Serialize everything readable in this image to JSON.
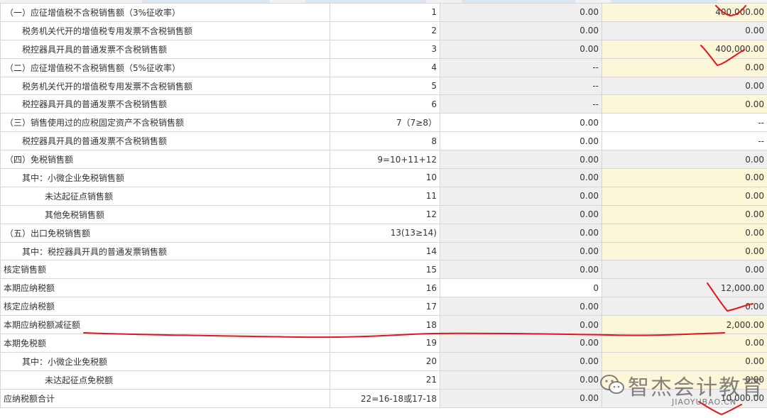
{
  "rows": [
    {
      "name": "（一）应征增值税不含税销售额（3%征收率）",
      "line": "1",
      "v1": "0.00",
      "v2": "400,000.00"
    },
    {
      "name": "税务机关代开的增值税专用发票不含税销售额",
      "line": "2",
      "v1": "0.00",
      "v2": "0.00"
    },
    {
      "name": "税控器具开具的普通发票不含税销售额",
      "line": "3",
      "v1": "0.00",
      "v2": "400,000.00"
    },
    {
      "name": "（二）应征增值税不含税销售额（5%征收率）",
      "line": "4",
      "v1": "--",
      "v2": "0.00"
    },
    {
      "name": "税务机关代开的增值税专用发票不含税销售额",
      "line": "5",
      "v1": "--",
      "v2": "0.00"
    },
    {
      "name": "税控器具开具的普通发票不含税销售额",
      "line": "6",
      "v1": "--",
      "v2": "0.00"
    },
    {
      "name": "（三）销售使用过的应税固定资产不含税销售额",
      "line": "7（7≥8）",
      "v1": "0.00",
      "v2": "--"
    },
    {
      "name": "税控器具开具的普通发票不含税销售额",
      "line": "8",
      "v1": "0.00",
      "v2": "--"
    },
    {
      "name": "（四）免税销售额",
      "line": "9=10+11+12",
      "v1": "0.00",
      "v2": "0.00"
    },
    {
      "name": "其中：小微企业免税销售额",
      "line": "10",
      "v1": "0.00",
      "v2": "0.00"
    },
    {
      "name": "未达起征点销售额",
      "line": "11",
      "v1": "0.00",
      "v2": "0.00"
    },
    {
      "name": "其他免税销售额",
      "line": "12",
      "v1": "0.00",
      "v2": "0.00"
    },
    {
      "name": "（五）出口免税销售额",
      "line": "13(13≥14)",
      "v1": "0.00",
      "v2": "0.00"
    },
    {
      "name": "其中：税控器具开具的普通发票销售额",
      "line": "14",
      "v1": "0.00",
      "v2": "0.00"
    },
    {
      "name": "核定销售额",
      "line": "15",
      "v1": "0.00",
      "v2": "0.00"
    },
    {
      "name": "本期应纳税额",
      "line": "16",
      "v1": "0",
      "v2": "12,000.00"
    },
    {
      "name": "核定应纳税额",
      "line": "17",
      "v1": "0.00",
      "v2": "0.00"
    },
    {
      "name": "本期应纳税额减征额",
      "line": "18",
      "v1": "0.00",
      "v2": "2,000.00"
    },
    {
      "name": "本期免税额",
      "line": "19",
      "v1": "0.00",
      "v2": "0.00"
    },
    {
      "name": "其中：小微企业免税额",
      "line": "20",
      "v1": "0.00",
      "v2": "0.00"
    },
    {
      "name": "未达起征点免税额",
      "line": "21",
      "v1": "0.00",
      "v2": "0.00"
    },
    {
      "name": "应纳税额合计",
      "line": "22=16-18或17-18",
      "v1": "0.00",
      "v2": "10,000.00"
    }
  ],
  "watermark": {
    "text": "智杰会计教育",
    "sub": "JIAOYUBAO.CN",
    "icon": "wechat-icon"
  },
  "colors": {
    "editable": "#fdf7d9",
    "readonly": "#efefef",
    "annotation": "#e8141b"
  }
}
